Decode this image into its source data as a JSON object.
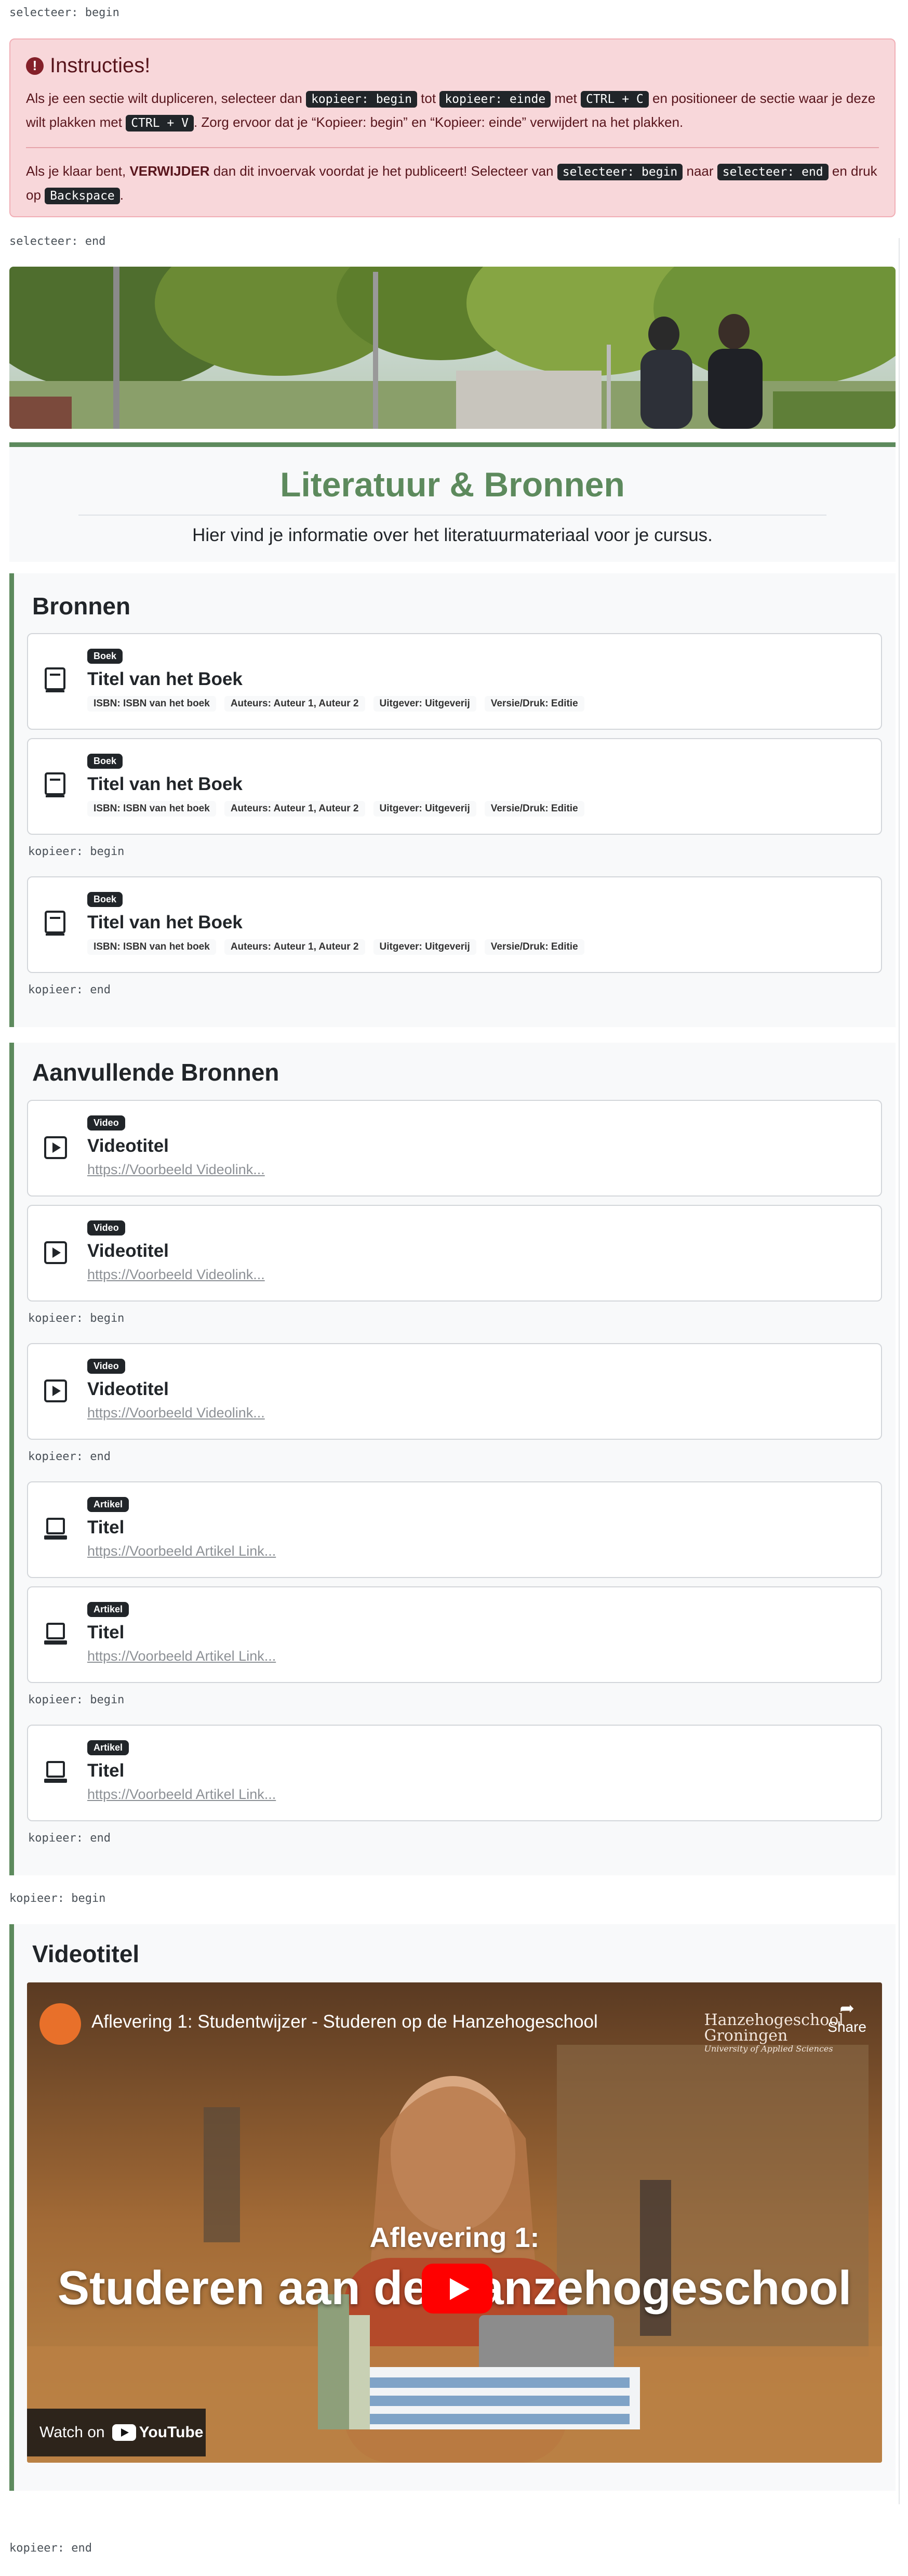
{
  "markers": {
    "select_begin": "selecteer: begin",
    "select_end": "selecteer: end",
    "copy_begin": "kopieer: begin",
    "copy_end": "kopieer: end"
  },
  "instructions": {
    "title": "Instructies!",
    "p1_a": "Als je een sectie wilt dupliceren, selecteer dan ",
    "p1_k1": "kopieer: begin",
    "p1_b": " tot ",
    "p1_k2": "kopieer: einde",
    "p1_c": " met ",
    "p1_k3": "CTRL + C",
    "p1_d": " en positioneer de sectie waar je deze wilt plakken met ",
    "p1_k4": "CTRL + V",
    "p1_e": ". Zorg ervoor dat je “Kopieer: begin” en “Kopieer: einde” verwijdert na het plakken.",
    "p2_a": "Als je klaar bent, ",
    "p2_strong": "VERWIJDER",
    "p2_b": " dan dit invoervak voordat je het publiceert! Selecteer van ",
    "p2_k1": "selecteer: begin",
    "p2_c": " naar ",
    "p2_k2": "selecteer: end",
    "p2_d": " en druk op ",
    "p2_k3": "Backspace",
    "p2_e": "."
  },
  "header": {
    "title": "Literatuur & Bronnen",
    "subtitle": "Hier vind je informatie over het literatuurmateriaal voor je cursus."
  },
  "bronnen": {
    "heading": "Bronnen",
    "books": [
      {
        "badge": "Boek",
        "title": "Titel van het Boek",
        "isbn": "ISBN: ISBN van het boek",
        "authors": "Auteurs: Auteur 1, Auteur 2",
        "publisher": "Uitgever: Uitgeverij",
        "edition": "Versie/Druk: Editie"
      },
      {
        "badge": "Boek",
        "title": "Titel van het Boek",
        "isbn": "ISBN: ISBN van het boek",
        "authors": "Auteurs: Auteur 1, Auteur 2",
        "publisher": "Uitgever: Uitgeverij",
        "edition": "Versie/Druk: Editie"
      },
      {
        "badge": "Boek",
        "title": "Titel van het Boek",
        "isbn": "ISBN: ISBN van het boek",
        "authors": "Auteurs: Auteur 1, Auteur 2",
        "publisher": "Uitgever: Uitgeverij",
        "edition": "Versie/Druk: Editie"
      }
    ]
  },
  "aanvullend": {
    "heading": "Aanvullende Bronnen",
    "videos": [
      {
        "badge": "Video",
        "title": "Videotitel",
        "link": "https://Voorbeeld Videolink..."
      },
      {
        "badge": "Video",
        "title": "Videotitel",
        "link": "https://Voorbeeld Videolink..."
      },
      {
        "badge": "Video",
        "title": "Videotitel",
        "link": "https://Voorbeeld Videolink..."
      }
    ],
    "articles": [
      {
        "badge": "Artikel",
        "title": "Titel",
        "link": "https://Voorbeeld Artikel Link..."
      },
      {
        "badge": "Artikel",
        "title": "Titel",
        "link": "https://Voorbeeld Artikel Link..."
      },
      {
        "badge": "Artikel",
        "title": "Titel",
        "link": "https://Voorbeeld Artikel Link..."
      }
    ]
  },
  "video_section": {
    "heading": "Videotitel",
    "player_title": "Aflevering 1: Studentwijzer - Studeren op de Hanzehogeschool",
    "share": "Share",
    "org_name_1": "Hanzehogeschool",
    "org_name_2": "Groningen",
    "org_tagline": "University of Applied Sciences",
    "episode": "Aflevering 1:",
    "episode_title": "Studeren aan de Hanzehogeschool",
    "watch_on": "Watch on",
    "youtube": "YouTube"
  },
  "colors": {
    "accent_green": "#5d8a5d",
    "alert_bg": "#f8d7da",
    "youtube_red": "#ff0000"
  }
}
